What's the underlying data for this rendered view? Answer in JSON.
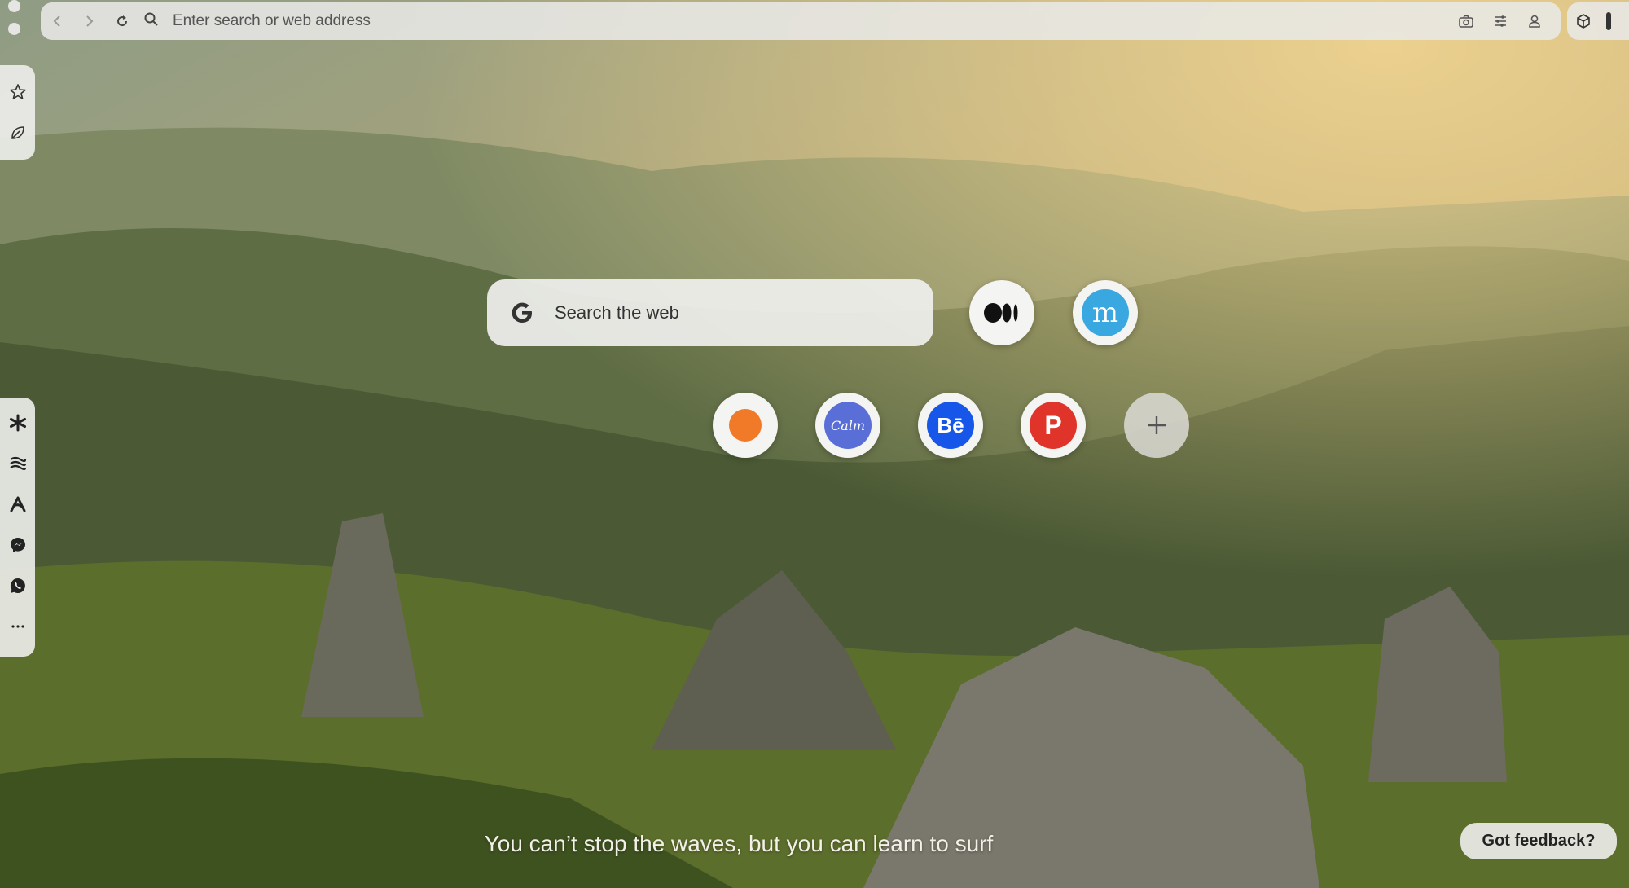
{
  "toolbar": {
    "address_placeholder": "Enter search or web address"
  },
  "search": {
    "label": "Search the web",
    "engine_icon": "google-icon"
  },
  "speed_dial": {
    "row1": [
      {
        "name": "medium-icon",
        "label": "Medium",
        "color": "#111111"
      },
      {
        "name": "m-site-icon",
        "label": "m",
        "color": "#3aa8e0"
      }
    ],
    "row2": [
      {
        "name": "orange-circle-icon",
        "color": "#f07a28"
      },
      {
        "name": "calm-icon",
        "label": "Calm",
        "color": "#5a6ed8"
      },
      {
        "name": "behance-icon",
        "label": "Bē",
        "color": "#1656e8"
      },
      {
        "name": "producthunt-p-icon",
        "label": "P",
        "color": "#e0342a"
      }
    ]
  },
  "quote": "You can’t stop the waves, but you can learn to surf",
  "feedback_label": "Got feedback?",
  "colors": {
    "toolbar_bg": "#e8e8e6",
    "accent_medium": "#111111",
    "accent_calm": "#5a6ed8",
    "accent_behance": "#1656e8",
    "accent_producthunt": "#e0342a",
    "accent_orange": "#f07a28"
  }
}
